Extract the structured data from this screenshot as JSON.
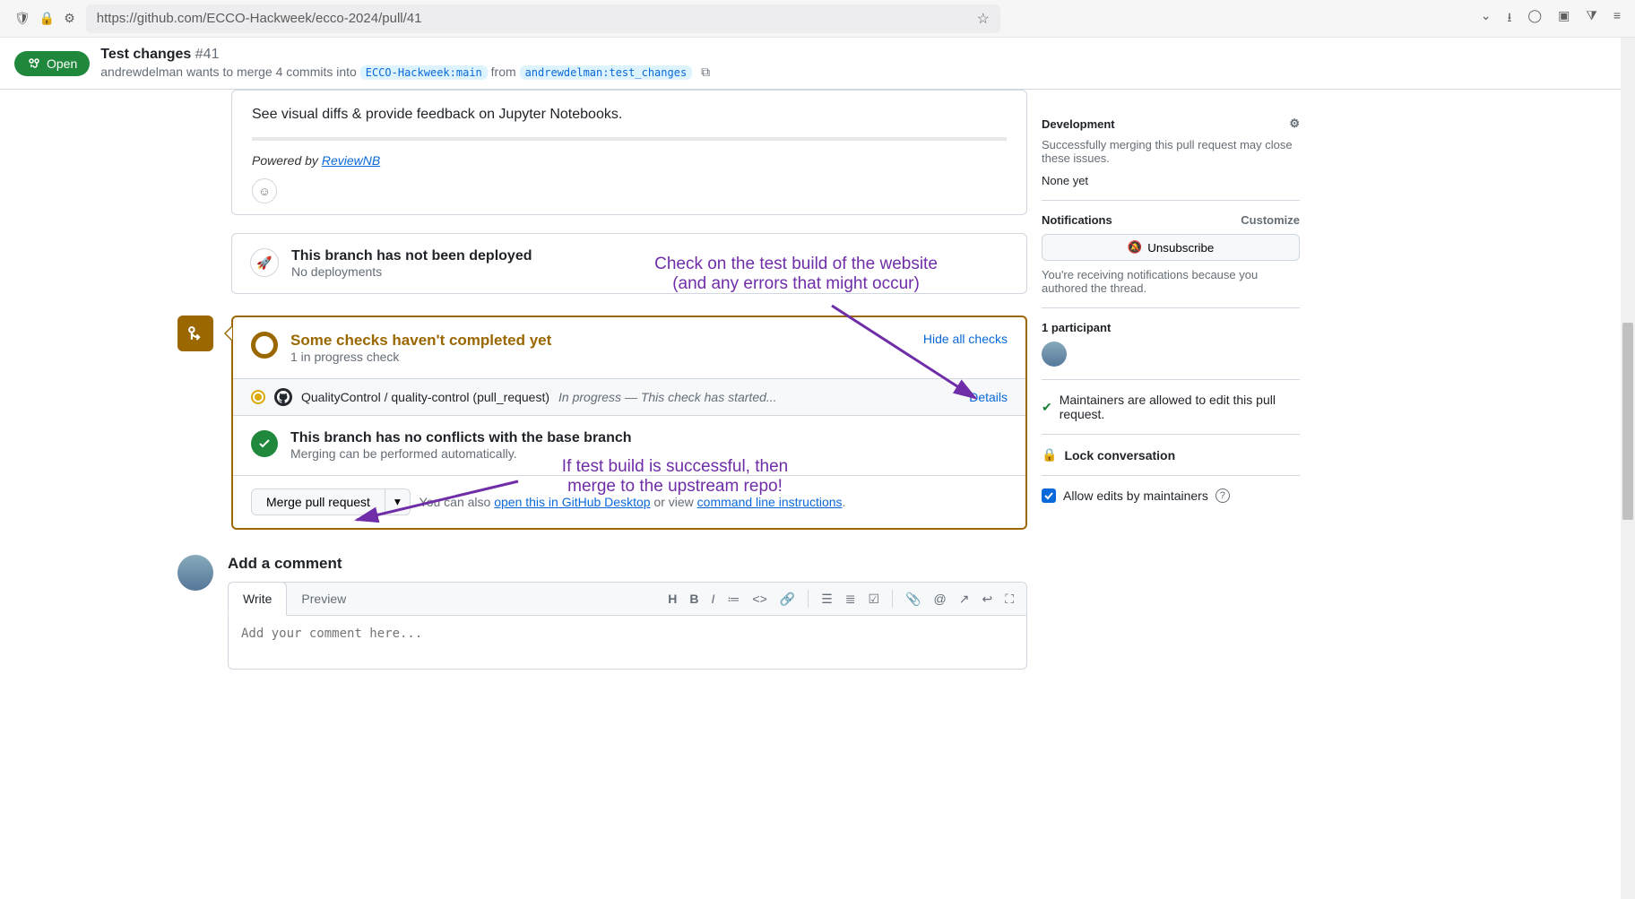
{
  "browser": {
    "url": "https://github.com/ECCO-Hackweek/ecco-2024/pull/41"
  },
  "pr": {
    "state": "Open",
    "title": "Test changes",
    "number": "#41",
    "author": "andrewdelman",
    "wants": "wants to merge 4 commits into",
    "base": "ECCO-Hackweek:main",
    "from": "from",
    "head": "andrewdelman:test_changes"
  },
  "comment": {
    "text": "See visual diffs & provide feedback on Jupyter Notebooks.",
    "powered_prefix": "Powered by ",
    "powered_link": "ReviewNB"
  },
  "deploy": {
    "heading": "This branch has not been deployed",
    "sub": "No deployments"
  },
  "checks": {
    "heading": "Some checks haven't completed yet",
    "sub": "1 in progress check",
    "hide": "Hide all checks",
    "item_name": "QualityControl / quality-control (pull_request)",
    "item_status": "In progress — This check has started...",
    "details": "Details"
  },
  "conflicts": {
    "heading": "This branch has no conflicts with the base branch",
    "sub": "Merging can be performed automatically."
  },
  "merge": {
    "button": "Merge pull request",
    "note_prefix": "You can also ",
    "desktop_link": "open this in GitHub Desktop",
    "note_mid": " or view ",
    "cli_link": "command line instructions",
    "note_suffix": "."
  },
  "annot": {
    "a1l1": "Check on the test build of the website",
    "a1l2": "(and any errors that might occur)",
    "a2l1": "If test build is successful, then",
    "a2l2": "merge to the upstream repo!"
  },
  "editor": {
    "heading": "Add a comment",
    "tab_write": "Write",
    "tab_preview": "Preview",
    "placeholder": "Add your comment here..."
  },
  "sidebar": {
    "dev_heading": "Development",
    "dev_text": "Successfully merging this pull request may close these issues.",
    "dev_none": "None yet",
    "notif_heading": "Notifications",
    "notif_customize": "Customize",
    "unsubscribe": "Unsubscribe",
    "notif_text": "You're receiving notifications because you authored the thread.",
    "participants": "1 participant",
    "maintainers": "Maintainers are allowed to edit this pull request.",
    "lock": "Lock conversation",
    "allow_edits": "Allow edits by maintainers"
  }
}
